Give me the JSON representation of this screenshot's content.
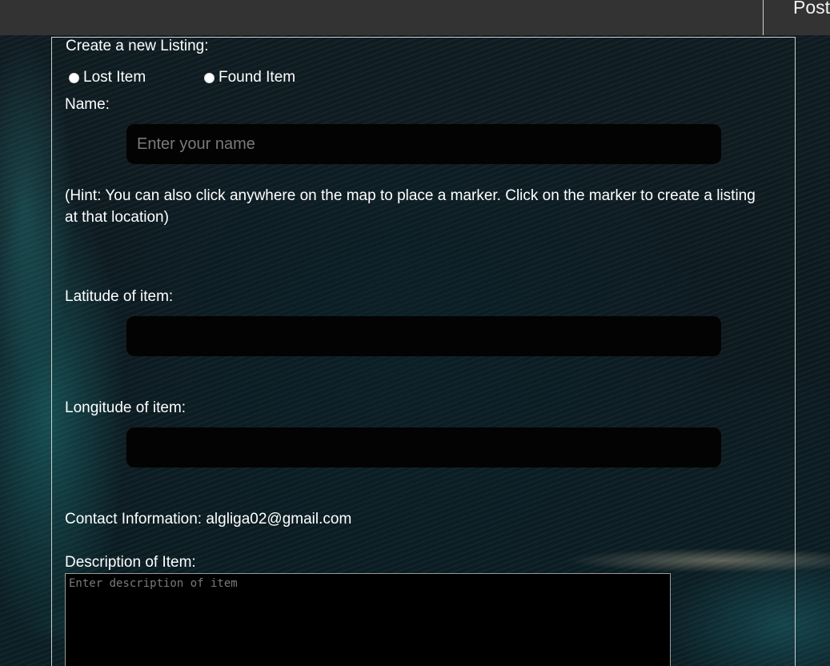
{
  "header": {
    "post_label": "Post"
  },
  "form": {
    "legend": "Create a new Listing:",
    "radios": [
      {
        "label": "Lost Item",
        "checked": false
      },
      {
        "label": "Found Item",
        "checked": false
      }
    ],
    "name_label": "Name:",
    "name_placeholder": "Enter your name",
    "name_value": "",
    "hint": "(Hint: You can also click anywhere on the map to place a marker. Click on the marker to create a listing at that location)",
    "latitude_label": "Latitude of item:",
    "latitude_value": "",
    "longitude_label": "Longitude of item:",
    "longitude_value": "",
    "contact_text": "Contact Information: algliga02@gmail.com",
    "description_label": "Description of Item:",
    "description_placeholder": "Enter description of item",
    "description_value": ""
  },
  "colors": {
    "topbar": "#333333",
    "input_bg": "#030303",
    "placeholder": "#7a7a7a",
    "text": "#ffffff"
  }
}
